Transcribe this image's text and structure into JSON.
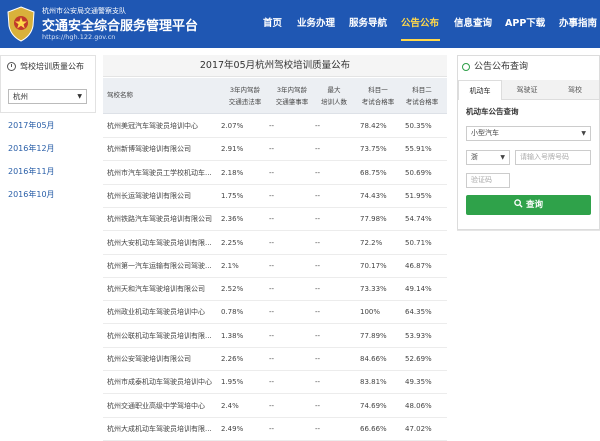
{
  "header": {
    "org": "杭州市公安局交通警察支队",
    "title": "交通安全综合服务管理平台",
    "url": "https://hgh.122.gov.cn",
    "nav": [
      {
        "label": "首页",
        "active": false
      },
      {
        "label": "业务办理",
        "active": false
      },
      {
        "label": "服务导航",
        "active": false
      },
      {
        "label": "公告公布",
        "active": true
      },
      {
        "label": "信息查询",
        "active": false
      },
      {
        "label": "APP下载",
        "active": false
      },
      {
        "label": "办事指南",
        "active": false
      }
    ]
  },
  "sidebar": {
    "title": "驾校培训质量公布",
    "city": "杭州",
    "months": [
      "2017年05月",
      "2016年12月",
      "2016年11月",
      "2016年10月"
    ]
  },
  "table": {
    "title": "2017年05月杭州驾校培训质量公布",
    "headers": {
      "name": "驾校名称",
      "violation": [
        "3年内驾龄",
        "交通违法率"
      ],
      "accident": [
        "3年内驾龄",
        "交通肇事率"
      ],
      "trainees": [
        "最大",
        "培训人数"
      ],
      "subject1": [
        "科目一",
        "考试合格率"
      ],
      "subject2": [
        "科目二",
        "考试合格率"
      ]
    },
    "rows": [
      [
        "杭州美冠汽车驾驶员培训中心",
        "2.07%",
        "--",
        "--",
        "78.42%",
        "50.35%"
      ],
      [
        "杭州新博驾驶培训有限公司",
        "2.91%",
        "--",
        "--",
        "73.75%",
        "55.91%"
      ],
      [
        "杭州市汽车驾驶员工学校机动车...",
        "2.18%",
        "--",
        "--",
        "68.75%",
        "50.69%"
      ],
      [
        "杭州长运驾驶培训有限公司",
        "1.75%",
        "--",
        "--",
        "74.43%",
        "51.95%"
      ],
      [
        "杭州铁路汽车驾驶员培训有限公司",
        "2.36%",
        "--",
        "--",
        "77.98%",
        "54.74%"
      ],
      [
        "杭州大安机动车驾驶员培训有限...",
        "2.25%",
        "--",
        "--",
        "72.2%",
        "50.71%"
      ],
      [
        "杭州第一汽车运输有限公司驾驶...",
        "2.1%",
        "--",
        "--",
        "70.17%",
        "46.87%"
      ],
      [
        "杭州天和汽车驾驶培训有限公司",
        "2.52%",
        "--",
        "--",
        "73.33%",
        "49.14%"
      ],
      [
        "杭州政业机动车驾驶员培训中心",
        "0.78%",
        "--",
        "--",
        "100%",
        "64.35%"
      ],
      [
        "杭州公联机动车驾驶员培训有限...",
        "1.38%",
        "--",
        "--",
        "77.89%",
        "53.93%"
      ],
      [
        "杭州公安驾驶培训有限公司",
        "2.26%",
        "--",
        "--",
        "84.66%",
        "52.69%"
      ],
      [
        "杭州市成泰机动车驾驶员培训中心",
        "1.95%",
        "--",
        "--",
        "83.81%",
        "49.35%"
      ],
      [
        "杭州交通职业高级中学驾培中心",
        "2.4%",
        "--",
        "--",
        "74.69%",
        "48.06%"
      ],
      [
        "杭州大成机动车驾驶员培训有限...",
        "2.49%",
        "--",
        "--",
        "66.66%",
        "47.02%"
      ]
    ]
  },
  "query_panel": {
    "title": "公告公布查询",
    "tabs": [
      {
        "label": "机动车",
        "active": true
      },
      {
        "label": "驾驶证",
        "active": false
      },
      {
        "label": "驾校",
        "active": false
      }
    ],
    "section_label": "机动车公告查询",
    "vehicle_type": "小型汽车",
    "province": "浙",
    "plate_placeholder": "请输入号牌号码",
    "captcha_placeholder": "验证码",
    "query_button": "查询"
  },
  "colors": {
    "header_bg": "#1f57b3",
    "nav_active": "#ffd84a",
    "link": "#2a5fa8",
    "query_button": "#2fa24a"
  }
}
